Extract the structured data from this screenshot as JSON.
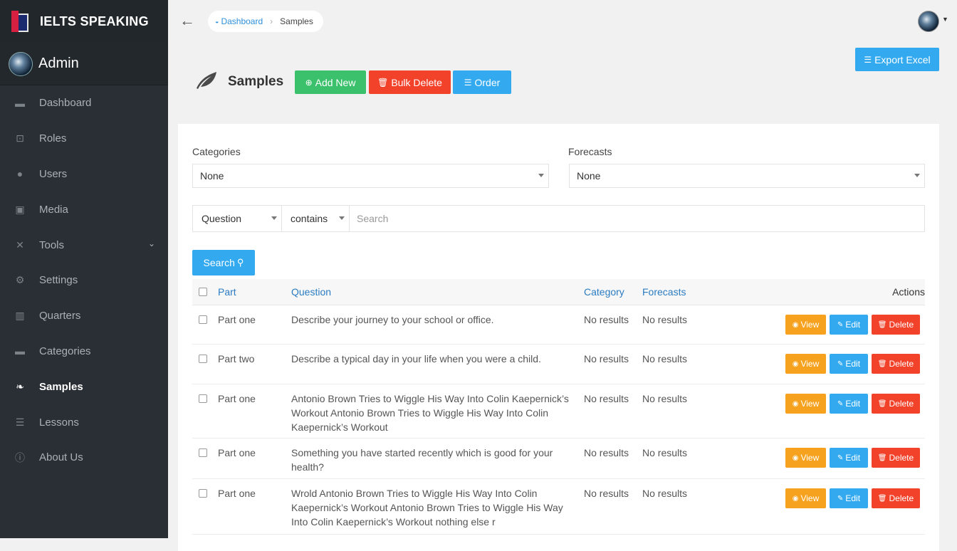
{
  "brand": {
    "title": "IELTS SPEAKING"
  },
  "admin": {
    "name": "Admin"
  },
  "sidebar": {
    "items": [
      {
        "label": "Dashboard",
        "icon": "dashboard-icon",
        "glyph": "▬"
      },
      {
        "label": "Roles",
        "icon": "lock-icon",
        "glyph": "⊡"
      },
      {
        "label": "Users",
        "icon": "user-icon",
        "glyph": "●"
      },
      {
        "label": "Media",
        "icon": "image-icon",
        "glyph": "▣"
      },
      {
        "label": "Tools",
        "icon": "tools-icon",
        "glyph": "✕",
        "chevron": "⌄"
      },
      {
        "label": "Settings",
        "icon": "gear-icon",
        "glyph": "⚙"
      },
      {
        "label": "Quarters",
        "icon": "bar-chart-icon",
        "glyph": "▥"
      },
      {
        "label": "Categories",
        "icon": "folder-icon",
        "glyph": "▬"
      },
      {
        "label": "Samples",
        "icon": "leaf-icon",
        "glyph": "❧",
        "active": true
      },
      {
        "label": "Lessons",
        "icon": "list-icon",
        "glyph": "☰"
      },
      {
        "label": "About Us",
        "icon": "info-icon",
        "glyph": "ⓘ"
      }
    ]
  },
  "breadcrumb": {
    "home": "Dashboard",
    "current": "Samples"
  },
  "header": {
    "title": "Samples",
    "add_new": "Add New",
    "bulk_delete": "Bulk Delete",
    "order": "Order",
    "export": "Export Excel"
  },
  "filters": {
    "categories_label": "Categories",
    "categories_value": "None",
    "forecasts_label": "Forecasts",
    "forecasts_value": "None",
    "field": "Question",
    "operator": "contains",
    "search_placeholder": "Search",
    "search_button": "Search"
  },
  "table": {
    "columns": {
      "part": "Part",
      "question": "Question",
      "category": "Category",
      "forecasts": "Forecasts",
      "actions": "Actions"
    },
    "action_labels": {
      "view": "View",
      "edit": "Edit",
      "delete": "Delete"
    },
    "rows": [
      {
        "part": "Part one",
        "question": "Describe your journey to your school or office.",
        "category": "No results",
        "forecasts": "No results"
      },
      {
        "part": "Part two",
        "question": "Describe a typical day in your life when you were a child.",
        "category": "No results",
        "forecasts": "No results"
      },
      {
        "part": "Part one",
        "question": "Antonio Brown Tries to Wiggle His Way Into Colin Kaepernick’s Workout Antonio Brown Tries to Wiggle His Way Into Colin Kaepernick’s Workout",
        "category": "No results",
        "forecasts": "No results"
      },
      {
        "part": "Part one",
        "question": "Something you have started recently which is good for your health?",
        "category": "No results",
        "forecasts": "No results"
      },
      {
        "part": "Part one",
        "question": "Wrold Antonio Brown Tries to Wiggle His Way Into Colin Kaepernick’s Workout Antonio Brown Tries to Wiggle His Way Into Colin Kaepernick’s Workout nothing else r",
        "category": "No results",
        "forecasts": "No results"
      }
    ]
  },
  "colors": {
    "sidebar_bg": "#2a2f35",
    "primary": "#33aaf0",
    "success": "#3bc16b",
    "danger": "#f2422a",
    "warning": "#f6a21e"
  }
}
